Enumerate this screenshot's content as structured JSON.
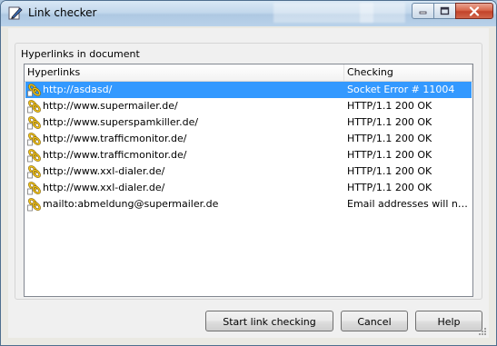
{
  "window": {
    "title": "Link checker",
    "minimize_icon": "minimize-icon",
    "maximize_icon": "maximize-icon",
    "close_icon": "close-icon"
  },
  "group": {
    "label": "Hyperlinks in document"
  },
  "table": {
    "columns": [
      "Hyperlinks",
      "Checking"
    ],
    "rows": [
      {
        "link": "http://asdasd/",
        "status": "Socket Error # 11004",
        "selected": true,
        "icon": "chain-link-icon"
      },
      {
        "link": "http://www.supermailer.de/",
        "status": "HTTP/1.1 200 OK",
        "icon": "chain-link-icon"
      },
      {
        "link": "http://www.superspamkiller.de/",
        "status": "HTTP/1.1 200 OK",
        "icon": "chain-link-icon"
      },
      {
        "link": "http://www.trafficmonitor.de/",
        "status": "HTTP/1.1 200 OK",
        "icon": "chain-link-icon"
      },
      {
        "link": "http://www.trafficmonitor.de/",
        "status": "HTTP/1.1 200 OK",
        "icon": "chain-link-icon"
      },
      {
        "link": "http://www.xxl-dialer.de/",
        "status": "HTTP/1.1 200 OK",
        "icon": "chain-link-icon"
      },
      {
        "link": "http://www.xxl-dialer.de/",
        "status": "HTTP/1.1 200 OK",
        "icon": "chain-link-icon"
      },
      {
        "link": "mailto:abmeldung@supermailer.de",
        "status": "Email addresses will not be checked",
        "icon": "chain-link-icon"
      }
    ]
  },
  "buttons": {
    "start": "Start link checking",
    "cancel": "Cancel",
    "help": "Help"
  },
  "colors": {
    "selection": "#3399ff",
    "titlebar": "#c3d8ec",
    "close": "#c3432a"
  }
}
